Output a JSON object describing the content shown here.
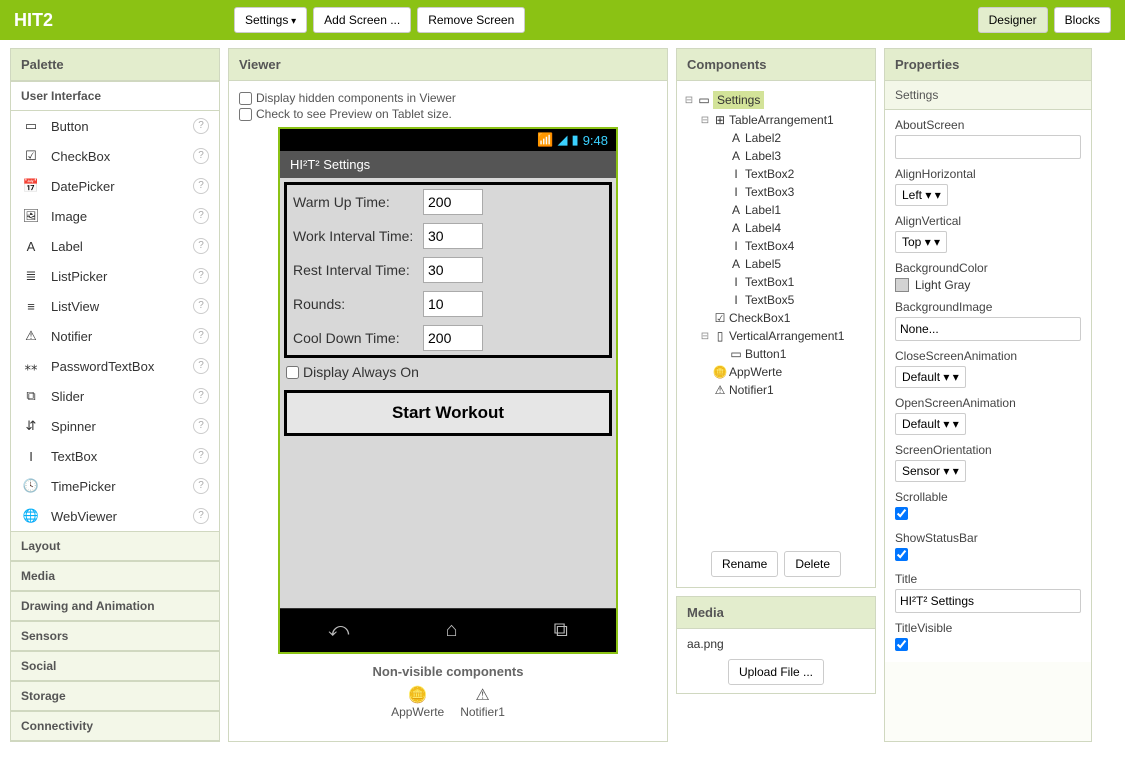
{
  "topbar": {
    "title": "HIT2",
    "settings_btn": "Settings",
    "add_screen_btn": "Add Screen ...",
    "remove_screen_btn": "Remove Screen",
    "designer_btn": "Designer",
    "blocks_btn": "Blocks"
  },
  "palette": {
    "header": "Palette",
    "categories": [
      "User Interface",
      "Layout",
      "Media",
      "Drawing and Animation",
      "Sensors",
      "Social",
      "Storage",
      "Connectivity"
    ],
    "ui_items": [
      {
        "icon": "▭",
        "label": "Button"
      },
      {
        "icon": "☑",
        "label": "CheckBox"
      },
      {
        "icon": "📅",
        "label": "DatePicker"
      },
      {
        "icon": "🖼",
        "label": "Image"
      },
      {
        "icon": "A",
        "label": "Label"
      },
      {
        "icon": "≣",
        "label": "ListPicker"
      },
      {
        "icon": "≡",
        "label": "ListView"
      },
      {
        "icon": "⚠",
        "label": "Notifier"
      },
      {
        "icon": "⁎⁎",
        "label": "PasswordTextBox"
      },
      {
        "icon": "⧉",
        "label": "Slider"
      },
      {
        "icon": "⇵",
        "label": "Spinner"
      },
      {
        "icon": "I",
        "label": "TextBox"
      },
      {
        "icon": "🕓",
        "label": "TimePicker"
      },
      {
        "icon": "🌐",
        "label": "WebViewer"
      }
    ]
  },
  "viewer": {
    "header": "Viewer",
    "cb_hidden": "Display hidden components in Viewer",
    "cb_tablet": "Check to see Preview on Tablet size.",
    "phone_time": "9:48",
    "phone_title": "HI²T² Settings",
    "fields": [
      {
        "label": "Warm Up Time:",
        "value": "200"
      },
      {
        "label": "Work Interval Time:",
        "value": "30"
      },
      {
        "label": "Rest Interval Time:",
        "value": "30"
      },
      {
        "label": "Rounds:",
        "value": "10"
      },
      {
        "label": "Cool Down Time:",
        "value": "200"
      }
    ],
    "cb_display_always": "Display Always On",
    "start_btn": "Start Workout",
    "nv_title": "Non-visible components",
    "nv_items": [
      {
        "icon": "🪙",
        "label": "AppWerte"
      },
      {
        "icon": "⚠",
        "label": "Notifier1"
      }
    ]
  },
  "components": {
    "header": "Components",
    "tree": [
      {
        "indent": 0,
        "toggle": "⊟",
        "icon": "▭",
        "label": "Settings",
        "selected": true
      },
      {
        "indent": 1,
        "toggle": "⊟",
        "icon": "⊞",
        "label": "TableArrangement1"
      },
      {
        "indent": 2,
        "toggle": "",
        "icon": "A",
        "label": "Label2"
      },
      {
        "indent": 2,
        "toggle": "",
        "icon": "A",
        "label": "Label3"
      },
      {
        "indent": 2,
        "toggle": "",
        "icon": "I",
        "label": "TextBox2"
      },
      {
        "indent": 2,
        "toggle": "",
        "icon": "I",
        "label": "TextBox3"
      },
      {
        "indent": 2,
        "toggle": "",
        "icon": "A",
        "label": "Label1"
      },
      {
        "indent": 2,
        "toggle": "",
        "icon": "A",
        "label": "Label4"
      },
      {
        "indent": 2,
        "toggle": "",
        "icon": "I",
        "label": "TextBox4"
      },
      {
        "indent": 2,
        "toggle": "",
        "icon": "A",
        "label": "Label5"
      },
      {
        "indent": 2,
        "toggle": "",
        "icon": "I",
        "label": "TextBox1"
      },
      {
        "indent": 2,
        "toggle": "",
        "icon": "I",
        "label": "TextBox5"
      },
      {
        "indent": 1,
        "toggle": "",
        "icon": "☑",
        "label": "CheckBox1"
      },
      {
        "indent": 1,
        "toggle": "⊟",
        "icon": "▯",
        "label": "VerticalArrangement1"
      },
      {
        "indent": 2,
        "toggle": "",
        "icon": "▭",
        "label": "Button1"
      },
      {
        "indent": 1,
        "toggle": "",
        "icon": "🪙",
        "label": "AppWerte"
      },
      {
        "indent": 1,
        "toggle": "",
        "icon": "⚠",
        "label": "Notifier1"
      }
    ],
    "rename_btn": "Rename",
    "delete_btn": "Delete"
  },
  "media": {
    "header": "Media",
    "file": "aa.png",
    "upload_btn": "Upload File ..."
  },
  "properties": {
    "header": "Properties",
    "subject": "Settings",
    "items": {
      "about_label": "AboutScreen",
      "about_value": "",
      "alignh_label": "AlignHorizontal",
      "alignh_value": "Left",
      "alignv_label": "AlignVertical",
      "alignv_value": "Top",
      "bgcolor_label": "BackgroundColor",
      "bgcolor_value": "Light Gray",
      "bgimg_label": "BackgroundImage",
      "bgimg_value": "None...",
      "closeanim_label": "CloseScreenAnimation",
      "closeanim_value": "Default",
      "openanim_label": "OpenScreenAnimation",
      "openanim_value": "Default",
      "orient_label": "ScreenOrientation",
      "orient_value": "Sensor",
      "scroll_label": "Scrollable",
      "statusbar_label": "ShowStatusBar",
      "title_label": "Title",
      "title_value": "HI²T² Settings",
      "titlevis_label": "TitleVisible"
    }
  }
}
